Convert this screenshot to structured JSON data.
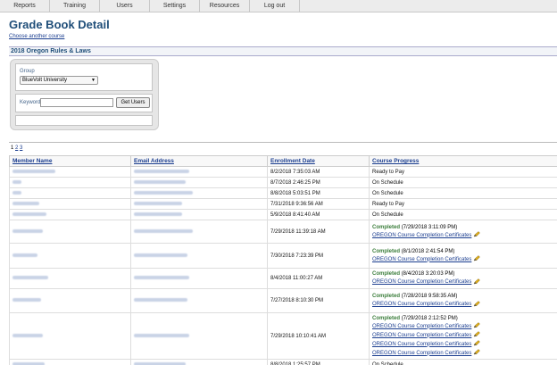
{
  "nav": {
    "items": [
      "Reports",
      "Training",
      "Users",
      "Settings",
      "Resources",
      "Log out"
    ]
  },
  "header": {
    "title": "Grade Book Detail",
    "choose_link": "Choose another course",
    "course_name": "2018 Oregon Rules & Laws"
  },
  "filters": {
    "group_label": "Group",
    "group_value": "BlueVolt University",
    "keyword_label": "Keyword",
    "keyword_value": "",
    "get_users_label": "Get Users"
  },
  "pager": {
    "current": "1",
    "pages": [
      "2",
      "3"
    ]
  },
  "table": {
    "columns": [
      "Member Name",
      "Email Address",
      "Enrollment Date",
      "Course Progress"
    ],
    "completed_word": "Completed",
    "cert_label": "OREGON Course Completion Certificates",
    "rows": [
      {
        "date": "8/2/2018 7:35:03 AM",
        "status": "Ready to Pay"
      },
      {
        "date": "8/7/2018 2:46:25 PM",
        "status": "On Schedule"
      },
      {
        "date": "8/8/2018 5:03:51 PM",
        "status": "On Schedule"
      },
      {
        "date": "7/31/2018 9:36:56 AM",
        "status": "Ready to Pay"
      },
      {
        "date": "5/9/2018 8:41:40 AM",
        "status": "On Schedule"
      },
      {
        "date": "7/29/2018 11:39:18 AM",
        "completed": [
          "(7/29/2018 3:11:09 PM)"
        ],
        "certs": 1
      },
      {
        "date": "7/30/2018 7:23:39 PM",
        "completed": [
          "(8/1/2018 2:41:54 PM)"
        ],
        "certs": 1
      },
      {
        "date": "8/4/2018 11:00:27 AM",
        "completed": [
          "(8/4/2018 3:20:03 PM)"
        ],
        "certs": 1
      },
      {
        "date": "7/27/2018 8:10:30 PM",
        "completed": [
          "(7/28/2018 9:58:35 AM)"
        ],
        "certs": 1
      },
      {
        "date": "7/29/2018 10:10:41 AM",
        "completed": [
          "(7/29/2018 2:12:52 PM)"
        ],
        "certs": 4
      },
      {
        "date": "8/8/2018 1:25:57 PM",
        "status": "On Schedule"
      }
    ]
  },
  "colors": {
    "title": "#1f4e79",
    "link": "#1a3d8f",
    "completed": "#3a7d3a"
  }
}
